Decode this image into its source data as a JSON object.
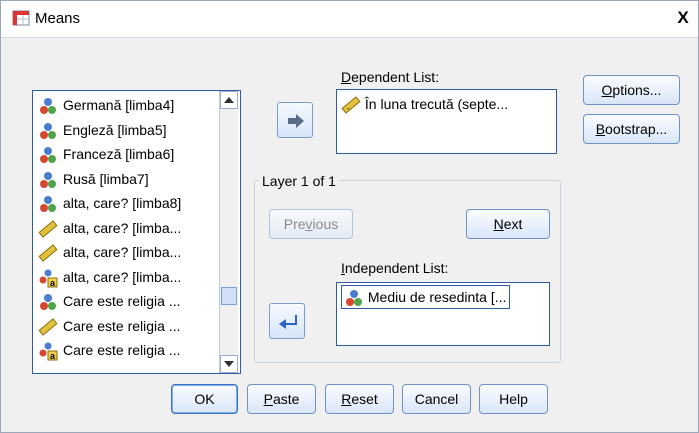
{
  "window": {
    "title": "Means",
    "close_label": "X"
  },
  "variables": {
    "items": [
      {
        "label": "Germană [limba4]",
        "icon": "nominal-icon"
      },
      {
        "label": "Engleză [limba5]",
        "icon": "nominal-icon"
      },
      {
        "label": "Franceză [limba6]",
        "icon": "nominal-icon"
      },
      {
        "label": "Rusă [limba7]",
        "icon": "nominal-icon"
      },
      {
        "label": "alta, care? [limba8]",
        "icon": "nominal-icon"
      },
      {
        "label": "alta, care? [limba...",
        "icon": "scale-icon"
      },
      {
        "label": "alta, care? [limba...",
        "icon": "scale-icon"
      },
      {
        "label": "alta, care? [limba...",
        "icon": "string-nominal-icon"
      },
      {
        "label": "Care este religia ...",
        "icon": "nominal-icon"
      },
      {
        "label": "Care este religia ...",
        "icon": "scale-icon"
      },
      {
        "label": "Care este religia ...",
        "icon": "string-nominal-icon"
      }
    ]
  },
  "dependent": {
    "label": "Dependent List:",
    "mnemonic": "D",
    "rest": "ependent List:",
    "item": "În luna trecută (septe...",
    "item_icon": "scale-icon"
  },
  "layer": {
    "label": "Layer 1 of 1",
    "previous": "Previous",
    "previous_pre": "Pre",
    "previous_mn": "v",
    "previous_post": "ious",
    "next": "Next",
    "next_mn": "N",
    "next_rest": "ext"
  },
  "independent": {
    "label": "Independent List:",
    "mnemonic": "I",
    "rest": "ndependent List:",
    "item": "Mediu de resedinta [...",
    "item_icon": "nominal-icon"
  },
  "side_buttons": {
    "options": "Options...",
    "options_mn": "O",
    "options_rest": "ptions...",
    "bootstrap": "Bootstrap...",
    "bootstrap_mn": "B",
    "bootstrap_rest": "ootstrap..."
  },
  "bottom_buttons": {
    "ok": "OK",
    "paste_mn": "P",
    "paste_rest": "aste",
    "reset_mn": "R",
    "reset_rest": "eset",
    "cancel": "Cancel",
    "help": "Help"
  },
  "colors": {
    "accent": "#2f5aa5",
    "button_border": "#6f93c8",
    "arrow_blue": "#2e62c4"
  }
}
